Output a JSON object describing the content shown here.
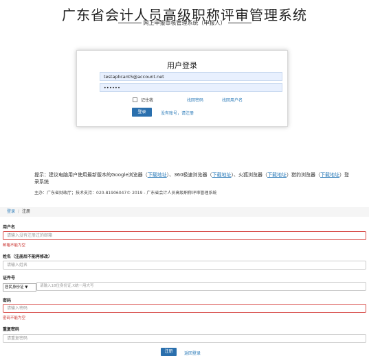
{
  "header": {
    "title": "广东省会计人员高级职称评审管理系统",
    "subtitle": "网上申报审核管理系统（申报人）"
  },
  "login": {
    "title": "用户登录",
    "username_value": "testaplicant5@account.net",
    "password_value": "••••••",
    "remember_label": "记住我",
    "find_password": "找回密码",
    "find_username": "找回用户名",
    "login_button": "登录",
    "no_account": "没有账号，请注册"
  },
  "tip": {
    "prefix": "提示：建议电脑用户使用最新版本的Google浏览器（",
    "download1": "下载地址",
    "mid1": "）、360极速浏览器（",
    "download2": "下载地址",
    "mid2": "）、火狐浏览器（",
    "download3": "下载地址",
    "mid3": "）猎豹浏览器（",
    "download4": "下载地址",
    "suffix": "）登录系统"
  },
  "footer": {
    "text": "主办：广东省财政厅；技术支持：020-81906047© 2019 - 广东省会计人员高级职称评审管理系统"
  },
  "breadcrumb": {
    "login": "登录",
    "sep": "/",
    "current": "注册"
  },
  "form": {
    "username_label": "用户名",
    "username_placeholder": "请输入没有注册过的邮箱",
    "username_error": "邮箱不能为空",
    "name_label": "姓名（注册后不能再修改）",
    "name_placeholder": "请输入姓名",
    "id_label": "证件号",
    "id_type": "居民身份证",
    "id_placeholder": "请输入18位身份证,X统一用大写",
    "password_label": "密码",
    "password_placeholder": "请输入密码",
    "password_error": "密码不能为空",
    "confirm_label": "重复密码",
    "confirm_placeholder": "请重复密码",
    "register_button": "注册",
    "back_login": "返回登录"
  }
}
